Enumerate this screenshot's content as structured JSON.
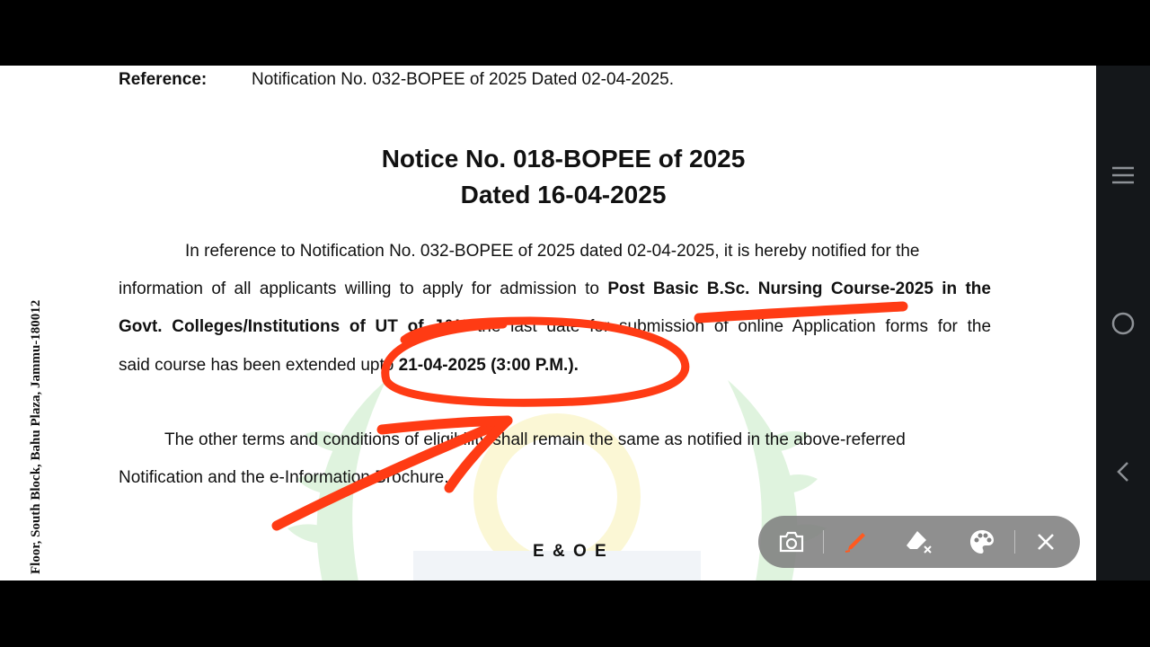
{
  "document": {
    "reference_label": "Reference:",
    "reference_text": "Notification No. 032-BOPEE of 2025 Dated 02-04-2025.",
    "title_line1": "Notice No. 018-BOPEE of 2025",
    "title_line2": "Dated 16-04-2025",
    "para1": {
      "line1": "In reference to Notification No. 032-BOPEE of 2025 dated 02-04-2025, it is hereby notified for the",
      "line2_normal": "information of all applicants willing to apply for admission to ",
      "line2_bold": "Post Basic B.Sc. Nursing Course-2025 in the",
      "line3_bold": "Govt. Colleges/Institutions of UT of J&K",
      "line3_normal": " the last date for submission of online Application forms for the",
      "line4_normal": "said course has been extended upto ",
      "line4_bold": "21-04-2025 (3:00 P.M.)."
    },
    "para2": {
      "line1": "The other terms and conditions of eligibility shall remain the same as notified in the above-referred",
      "line2": "Notification and the e-Information Brochure."
    },
    "footer_mark": "E & O E",
    "side_address": "Floor, South Block, Bahu Plaza, Jammu-180012"
  },
  "annotation": {
    "color": "#ff3b14"
  },
  "nav_bar": {
    "items": [
      "menu-icon",
      "home-circle-icon",
      "back-chevron-icon"
    ],
    "color": "#8d9196"
  },
  "toolbar": {
    "tools": [
      "camera-icon",
      "pen-icon",
      "eraser-icon",
      "palette-icon",
      "close-icon"
    ],
    "active_pen_color": "#ff5a1f"
  }
}
